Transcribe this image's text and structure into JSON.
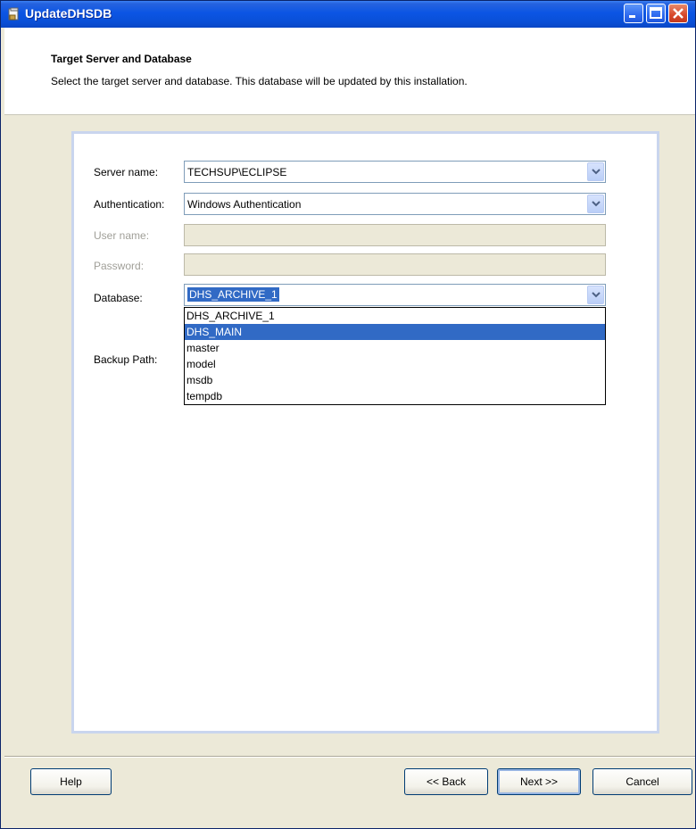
{
  "window": {
    "title": "UpdateDHSDB"
  },
  "header": {
    "title": "Target Server and Database",
    "description": "Select the target server and database. This database will be updated by this installation."
  },
  "form": {
    "server_label": "Server name:",
    "server_value": "TECHSUP\\ECLIPSE",
    "auth_label": "Authentication:",
    "auth_value": "Windows Authentication",
    "user_label": "User name:",
    "password_label": "Password:",
    "database_label": "Database:",
    "database_value": "DHS_ARCHIVE_1",
    "backup_label": "Backup Path:",
    "database_options": [
      "DHS_ARCHIVE_1",
      "DHS_MAIN",
      "master",
      "model",
      "msdb",
      "tempdb"
    ],
    "highlighted_option": "DHS_MAIN"
  },
  "buttons": {
    "help": "Help",
    "back": "<< Back",
    "next": "Next >>",
    "cancel": "Cancel"
  },
  "colors": {
    "selection": "#316ac5",
    "titlebar": "#0a4fd6"
  }
}
